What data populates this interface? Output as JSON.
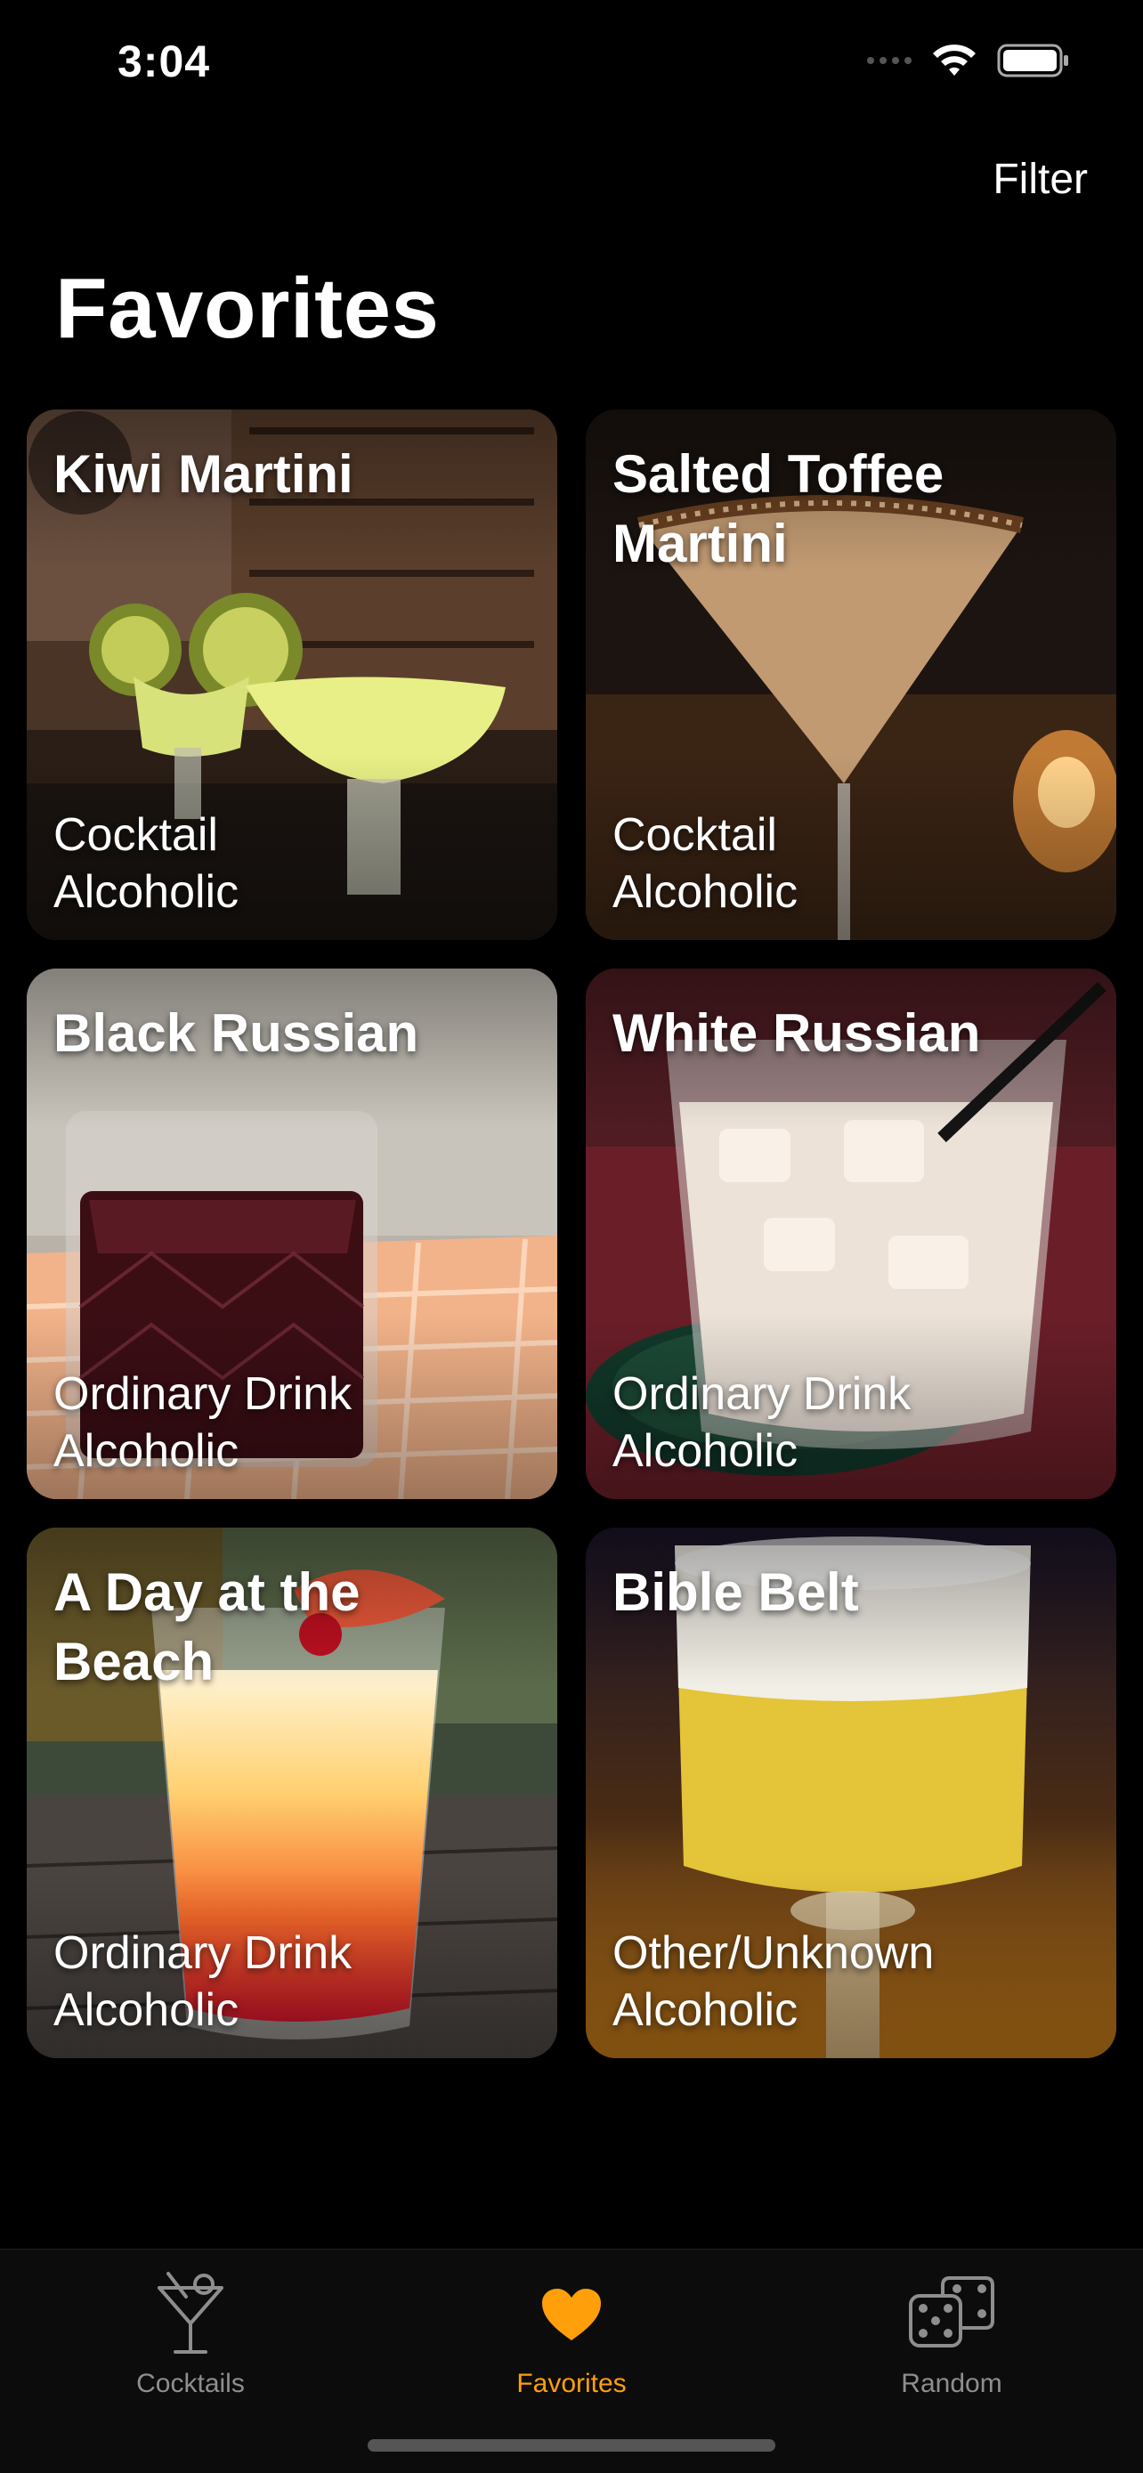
{
  "status": {
    "time": "3:04"
  },
  "nav": {
    "filter_label": "Filter",
    "title": "Favorites"
  },
  "accent_color": "#ff9f0a",
  "cards": [
    {
      "title": "Kiwi Martini",
      "category": "Cocktail",
      "alcohol": "Alcoholic"
    },
    {
      "title": "Salted Toffee Martini",
      "category": "Cocktail",
      "alcohol": "Alcoholic"
    },
    {
      "title": "Black Russian",
      "category": "Ordinary Drink",
      "alcohol": "Alcoholic"
    },
    {
      "title": "White Russian",
      "category": "Ordinary Drink",
      "alcohol": "Alcoholic"
    },
    {
      "title": "A Day at the Beach",
      "category": "Ordinary Drink",
      "alcohol": "Alcoholic"
    },
    {
      "title": "Bible Belt",
      "category": "Other/Unknown",
      "alcohol": "Alcoholic"
    }
  ],
  "tabs": [
    {
      "label": "Cocktails",
      "icon": "martini-glass-icon",
      "active": false
    },
    {
      "label": "Favorites",
      "icon": "heart-icon",
      "active": true
    },
    {
      "label": "Random",
      "icon": "dice-icon",
      "active": false
    }
  ]
}
